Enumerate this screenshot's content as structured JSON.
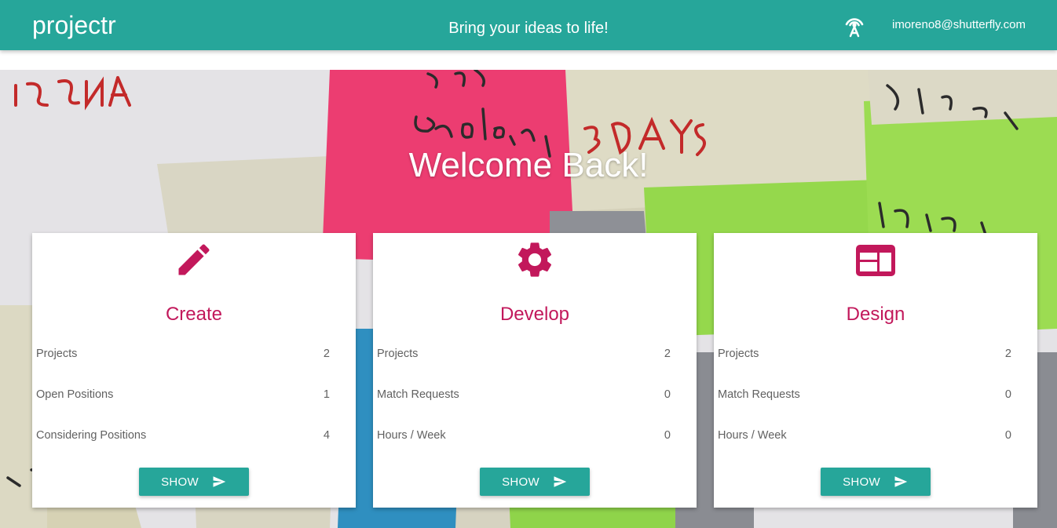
{
  "header": {
    "brand": "projectr",
    "tagline": "Bring your ideas to life!",
    "nav_icon": "broadcast-tower-icon",
    "user_email": "imoreno8@shutterfly.com"
  },
  "hero": {
    "welcome": "Welcome Back!"
  },
  "theme": {
    "primary": "#26a69a",
    "accent": "#c2185b"
  },
  "cards": [
    {
      "icon": "pencil-icon",
      "title": "Create",
      "stats": [
        {
          "label": "Projects",
          "value": "2"
        },
        {
          "label": "Open Positions",
          "value": "1"
        },
        {
          "label": "Considering Positions",
          "value": "4"
        }
      ],
      "button": "SHOW"
    },
    {
      "icon": "gear-icon",
      "title": "Develop",
      "stats": [
        {
          "label": "Projects",
          "value": "2"
        },
        {
          "label": "Match Requests",
          "value": "0"
        },
        {
          "label": "Hours / Week",
          "value": "0"
        }
      ],
      "button": "SHOW"
    },
    {
      "icon": "web-layout-icon",
      "title": "Design",
      "stats": [
        {
          "label": "Projects",
          "value": "2"
        },
        {
          "label": "Match Requests",
          "value": "0"
        },
        {
          "label": "Hours / Week",
          "value": "0"
        }
      ],
      "button": "SHOW"
    }
  ]
}
